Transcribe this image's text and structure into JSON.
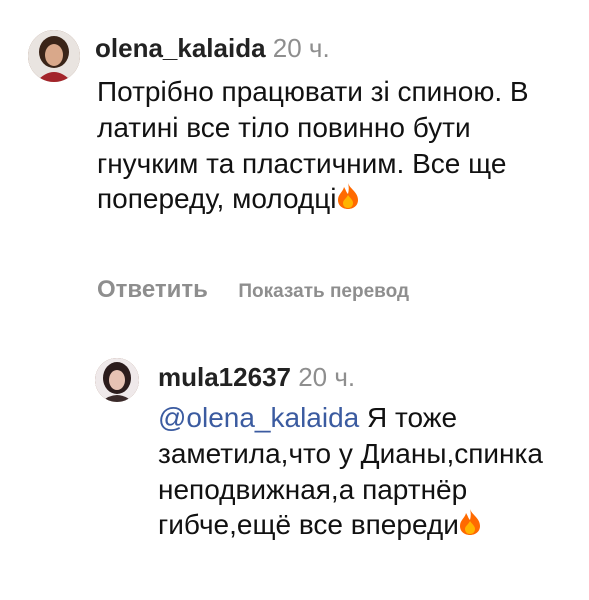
{
  "comments": [
    {
      "username": "olena_kalaida",
      "time": "20 ч.",
      "text": "Потрібно працювати зі спиною. В латині все тіло повинно бути гнучким та пластичним. Все ще попереду, молодці",
      "emoji": "fire-icon",
      "reply_label": "Ответить",
      "translate_label": "Показать перевод"
    },
    {
      "username": "mula12637",
      "time": "20 ч.",
      "mention": "@olena_kalaida",
      "text": " Я тоже заметила,что у Дианы,спинка неподвижная,а партнёр гибче,ещё все впереди",
      "emoji": "fire-icon"
    }
  ],
  "colors": {
    "mention": "#3b5ba0",
    "muted": "#8e8e8e"
  }
}
